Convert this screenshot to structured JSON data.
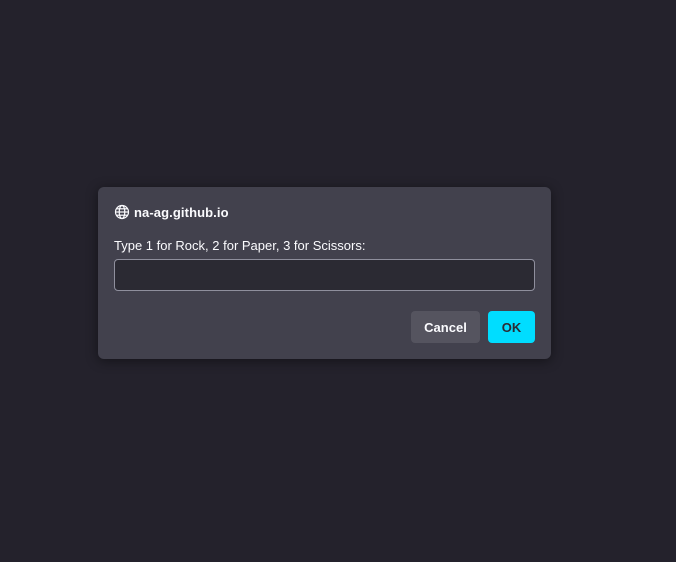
{
  "dialog": {
    "origin": "na-ag.github.io",
    "origin_icon": "globe-icon",
    "message": "Type 1 for Rock, 2 for Paper, 3 for Scissors:",
    "input_value": "",
    "cancel_label": "Cancel",
    "ok_label": "OK"
  },
  "colors": {
    "background": "#24222c",
    "dialog_background": "#42414d",
    "accent": "#00ddff"
  }
}
